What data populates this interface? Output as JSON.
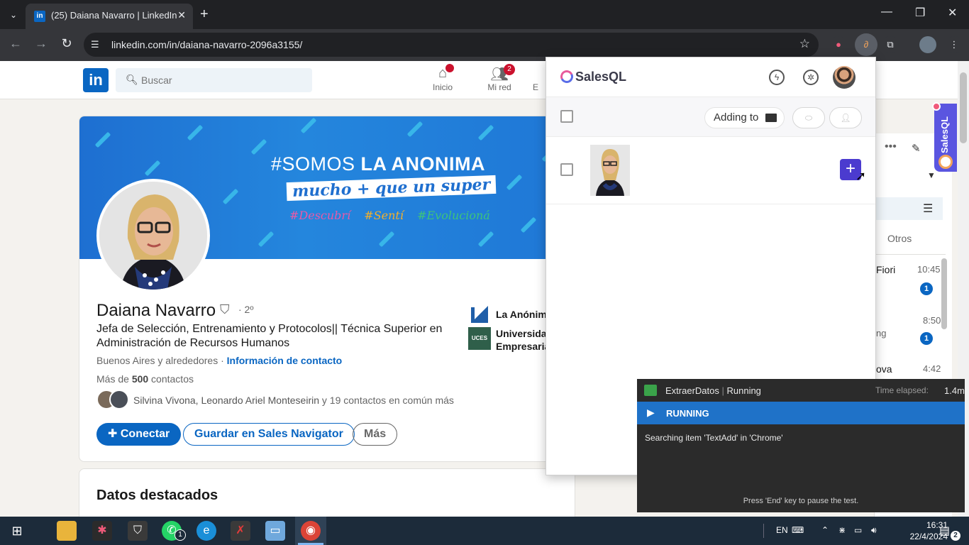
{
  "browser": {
    "tab_title": "(25) Daiana Navarro | LinkedIn",
    "tab_favicon": "in",
    "url": "linkedin.com/in/daiana-navarro-2096a3155/"
  },
  "linkedin": {
    "logo": "in",
    "search_placeholder": "Buscar",
    "nav": [
      {
        "label": "Inicio",
        "badge": ""
      },
      {
        "label": "Mi red",
        "badge": "2"
      },
      {
        "label": "E",
        "badge": ""
      }
    ]
  },
  "banner": {
    "line1_a": "#SOMOS ",
    "line1_b": "LA ANONIMA",
    "line2": "mucho + que un super",
    "tags": [
      "#Descubrí",
      "#Sentí",
      "#Evolucioná"
    ],
    "tag_colors": [
      "#e85aa8",
      "#f2b02c",
      "#3ec47a"
    ]
  },
  "profile": {
    "name": "Daiana Navarro",
    "degree": "· 2º",
    "headline": "Jefa de Selección, Entrenamiento y Protocolos|| Técnica Superior en Administración de Recursos Humanos",
    "location": "Buenos Aires y alrededores · ",
    "contact_info": "Información de contacto",
    "connections_prefix": "Más de ",
    "connections_bold": "500",
    "connections_suffix": " contactos",
    "mutual_names": "Silvina Vivona, Leonardo Ariel Monteseirin",
    "mutual_suffix": " y 19 contactos en común más",
    "btn_connect": "Conectar",
    "btn_sales_nav": "Guardar en Sales Navigator",
    "btn_more": "Más",
    "experience": [
      {
        "line1": "La Anónima",
        "line2": ""
      },
      {
        "line1": "Universidad",
        "line2": "Empresaria"
      }
    ],
    "highlights_title": "Datos destacados"
  },
  "messaging": {
    "otros": "Otros",
    "rows": [
      {
        "name": "Fiori",
        "time": "10:45",
        "unread": "1"
      },
      {
        "name": "ng",
        "time": "8:50",
        "unread": "1"
      },
      {
        "name": "ova",
        "time": "4:42",
        "unread": ""
      }
    ]
  },
  "salesql": {
    "brand": "SalesQL",
    "adding_to": "Adding to",
    "side_tab": "SalesQL",
    "add_button": "+"
  },
  "runner": {
    "name": "ExtraerDatos",
    "state": "Running",
    "elapsed_label": "Time elapsed:",
    "elapsed": "1.4m",
    "status": "RUNNING",
    "message": "Searching item 'TextAdd' in 'Chrome'",
    "footer": "Press 'End' key to pause the test."
  },
  "taskbar": {
    "lang": "EN",
    "time": "16:31",
    "date": "22/4/2024",
    "notifications": "2",
    "whatsapp_badge": "1"
  },
  "colors": {
    "linkedin_blue": "#0a66c2",
    "salesql_purple": "#4b3bcf",
    "runner_blue": "#1f72c8"
  }
}
